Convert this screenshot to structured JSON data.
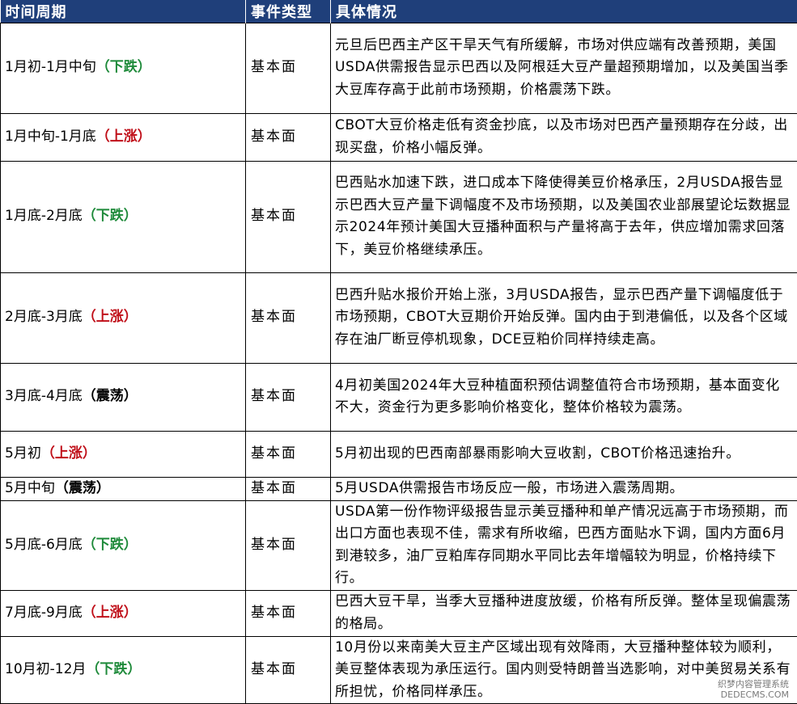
{
  "headers": {
    "period": "时间周期",
    "type": "事件类型",
    "detail": "具体情况"
  },
  "rows": [
    {
      "period": "1月初-1月中旬",
      "trend": "（下跌）",
      "trend_kind": "down",
      "type": "基本面",
      "detail": "元旦后巴西主产区干旱天气有所缓解，市场对供应端有改善预期，美国USDA供需报告显示巴西以及阿根廷大豆产量超预期增加，以及美国当季大豆库存高于此前市场预期，价格震荡下跌。"
    },
    {
      "period": "1月中旬-1月底",
      "trend": "（上涨）",
      "trend_kind": "up",
      "type": "基本面",
      "detail": "CBOT大豆价格走低有资金抄底，以及市场对巴西产量预期存在分歧，出现买盘，价格小幅反弹。"
    },
    {
      "period": "1月底-2月底",
      "trend": "（下跌）",
      "trend_kind": "down",
      "type": "基本面",
      "detail": "巴西贴水加速下跌，进口成本下降使得美豆价格承压，2月USDA报告显示巴西大豆产量下调幅度不及市场预期，以及美国农业部展望论坛数据显示2024年预计美国大豆播种面积与产量将高于去年，供应增加需求回落下，美豆价格继续承压。"
    },
    {
      "period": "2月底-3月底",
      "trend": "（上涨）",
      "trend_kind": "up",
      "type": "基本面",
      "detail": "巴西升贴水报价开始上涨，3月USDA报告，显示巴西产量下调幅度低于市场预期，CBOT大豆期价开始反弹。国内由于到港偏低，以及各个区域存在油厂断豆停机现象，DCE豆粕价同样持续走高。"
    },
    {
      "period": "3月底-4月底",
      "trend": "（震荡）",
      "trend_kind": "flat",
      "type": "基本面",
      "detail": "4月初美国2024年大豆种植面积预估调整值符合市场预期，基本面变化不大，资金行为更多影响价格变化，整体价格较为震荡。"
    },
    {
      "period": "5月初",
      "trend": "（上涨）",
      "trend_kind": "up",
      "type": "基本面",
      "detail": "5月初出现的巴西南部暴雨影响大豆收割，CBOT价格迅速抬升。"
    },
    {
      "period": "5月中旬",
      "trend": "（震荡）",
      "trend_kind": "flat",
      "type": "基本面",
      "detail": "5月USDA供需报告市场反应一般，市场进入震荡周期。"
    },
    {
      "period": "5月底-6月底",
      "trend": "（下跌）",
      "trend_kind": "down",
      "type": "基本面",
      "detail": "USDA第一份作物评级报告显示美豆播种和单产情况远高于市场预期，而出口方面也表现不佳，需求有所收缩，巴西方面贴水下调，国内方面6月到港较多，油厂豆粕库存同期水平同比去年增幅较为明显，价格持续下行。"
    },
    {
      "period": "7月底-9月底",
      "trend": "（上涨）",
      "trend_kind": "up",
      "type": "基本面",
      "detail": "巴西大豆干旱，当季大豆播种进度放缓，价格有所反弹。整体呈现偏震荡的格局。"
    },
    {
      "period": "10月初-12月",
      "trend": "（下跌）",
      "trend_kind": "down",
      "type": "基本面",
      "detail": "10月份以来南美大豆主产区域出现有效降雨，大豆播种整体较为顺利，美豆整体表现为承压运行。国内则受特朗普当选影响，对中美贸易关系有所担忧，价格同样承压。"
    }
  ],
  "watermark": {
    "line1": "织梦内容管理系统",
    "line2": "DEDECMS.COM"
  }
}
